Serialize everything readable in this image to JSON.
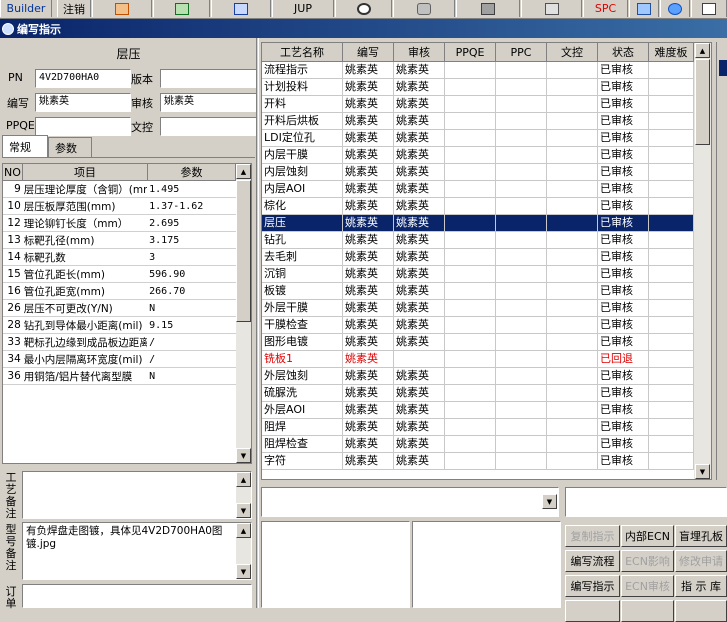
{
  "toolbar": {
    "builder": "Builder",
    "logout": "注销",
    "jup": "JUP",
    "spc": "SPC"
  },
  "window": {
    "title": "编写指示"
  },
  "left": {
    "section_title": "层压",
    "pn_label": "PN",
    "pn_value": "4V2D700HA0",
    "version_label": "版本",
    "version_value": "",
    "author_label": "编写",
    "author_value": "姚素英",
    "review_label": "审核",
    "review_value": "姚素英",
    "ppqe_label": "PPQE",
    "ppqe_value": "",
    "doc_label": "文控",
    "doc_value": "",
    "tabs": [
      "常规",
      "参数"
    ],
    "param_headers": [
      "NO",
      "项目",
      "参数"
    ],
    "params": [
      {
        "no": "9",
        "item": "层压理论厚度（含铜）(mm)",
        "value": "1.495"
      },
      {
        "no": "10",
        "item": "层压板厚范围(mm)",
        "value": "1.37-1.62"
      },
      {
        "no": "12",
        "item": "理论铆钉长度（mm）",
        "value": "2.695"
      },
      {
        "no": "13",
        "item": "标靶孔径(mm)",
        "value": "3.175"
      },
      {
        "no": "14",
        "item": "标靶孔数",
        "value": "3"
      },
      {
        "no": "15",
        "item": "管位孔距长(mm)",
        "value": "596.90"
      },
      {
        "no": "16",
        "item": "管位孔距宽(mm)",
        "value": "266.70"
      },
      {
        "no": "26",
        "item": "层压不可更改(Y/N)",
        "value": "N"
      },
      {
        "no": "28",
        "item": "钻孔到导体最小距离(mil)",
        "value": "9.15"
      },
      {
        "no": "33",
        "item": "靶标孔边缘到成品板边距离",
        "value": "/"
      },
      {
        "no": "34",
        "item": "最小内层隔离环宽度(mil)",
        "value": "/"
      },
      {
        "no": "36",
        "item": "用铜箔/铝片替代离型膜",
        "value": "N"
      }
    ],
    "process_note_label": "工艺备注",
    "process_note_value": "",
    "model_note_label": "型号备注",
    "model_note_value": "有负焊盘走图镀，具体见4V2D700HA0图镀.jpg",
    "order_note_label": "订单"
  },
  "grid": {
    "headers": [
      "工艺名称",
      "编写",
      "审核",
      "PPQE",
      "PPC",
      "文控",
      "状态",
      "难度板"
    ],
    "rows": [
      {
        "name": "流程指示",
        "author": "姚素英",
        "review": "姚素英",
        "status": "已审核"
      },
      {
        "name": "计划投料",
        "author": "姚素英",
        "review": "姚素英",
        "status": "已审核"
      },
      {
        "name": "开料",
        "author": "姚素英",
        "review": "姚素英",
        "status": "已审核"
      },
      {
        "name": "开料后烘板",
        "author": "姚素英",
        "review": "姚素英",
        "status": "已审核"
      },
      {
        "name": "LDI定位孔",
        "author": "姚素英",
        "review": "姚素英",
        "status": "已审核"
      },
      {
        "name": "内层干膜",
        "author": "姚素英",
        "review": "姚素英",
        "status": "已审核"
      },
      {
        "name": "内层蚀刻",
        "author": "姚素英",
        "review": "姚素英",
        "status": "已审核"
      },
      {
        "name": "内层AOI",
        "author": "姚素英",
        "review": "姚素英",
        "status": "已审核"
      },
      {
        "name": "棕化",
        "author": "姚素英",
        "review": "姚素英",
        "status": "已审核"
      },
      {
        "name": "层压",
        "author": "姚素英",
        "review": "姚素英",
        "status": "已审核"
      },
      {
        "name": "钻孔",
        "author": "姚素英",
        "review": "姚素英",
        "status": "已审核"
      },
      {
        "name": "去毛刺",
        "author": "姚素英",
        "review": "姚素英",
        "status": "已审核"
      },
      {
        "name": "沉铜",
        "author": "姚素英",
        "review": "姚素英",
        "status": "已审核"
      },
      {
        "name": "板镀",
        "author": "姚素英",
        "review": "姚素英",
        "status": "已审核"
      },
      {
        "name": "外层干膜",
        "author": "姚素英",
        "review": "姚素英",
        "status": "已审核"
      },
      {
        "name": "干膜检查",
        "author": "姚素英",
        "review": "姚素英",
        "status": "已审核"
      },
      {
        "name": "图形电镀",
        "author": "姚素英",
        "review": "姚素英",
        "status": "已审核"
      },
      {
        "name": "铣板1",
        "author": "姚素英",
        "review": "",
        "status": "已回退"
      },
      {
        "name": "外层蚀刻",
        "author": "姚素英",
        "review": "姚素英",
        "status": "已审核"
      },
      {
        "name": "硫脲洗",
        "author": "姚素英",
        "review": "姚素英",
        "status": "已审核"
      },
      {
        "name": "外层AOI",
        "author": "姚素英",
        "review": "姚素英",
        "status": "已审核"
      },
      {
        "name": "阻焊",
        "author": "姚素英",
        "review": "姚素英",
        "status": "已审核"
      },
      {
        "name": "阻焊检查",
        "author": "姚素英",
        "review": "姚素英",
        "status": "已审核"
      },
      {
        "name": "字符",
        "author": "姚素英",
        "review": "姚素英",
        "status": "已审核"
      }
    ],
    "selected_index": 9,
    "red_index": 17
  },
  "buttons": {
    "copy": "复制指示",
    "internal_ecn": "内部ECN",
    "buried_hole": "盲埋孔板",
    "edit_flow": "编写流程",
    "ecn_impact": "ECN影响",
    "modify_apply": "修改申请",
    "edit_instr": "编写指示",
    "ecn_review": "ECN审核",
    "instr_lib": "指 示 库"
  }
}
